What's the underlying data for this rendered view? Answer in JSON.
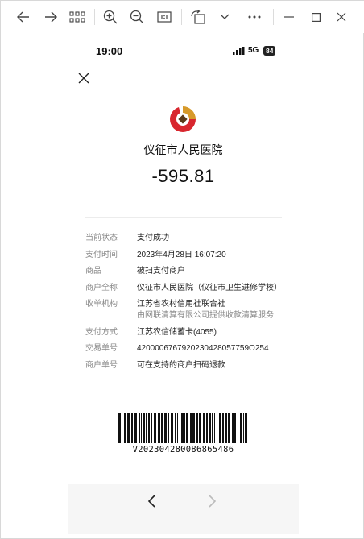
{
  "toolbar": {
    "icons": [
      "back-arrow-icon",
      "forward-arrow-icon",
      "grid-icon",
      "zoom-in-icon",
      "zoom-out-icon",
      "actual-size-icon",
      "rotate-icon",
      "chevron-down-icon",
      "more-icon",
      "minimize-icon",
      "maximize-icon",
      "close-icon"
    ]
  },
  "status_bar": {
    "time": "19:00",
    "network": "5G",
    "battery": "84"
  },
  "receipt": {
    "merchant": "仪征市人民医院",
    "amount": "-595.81",
    "details": [
      {
        "label": "当前状态",
        "value": "支付成功"
      },
      {
        "label": "支付时间",
        "value": "2023年4月28日 16:07:20"
      },
      {
        "label": "商品",
        "value": "被扫支付商户"
      },
      {
        "label": "商户全称",
        "value": "仪征市人民医院（仪征市卫生进修学校）"
      },
      {
        "label": "收单机构",
        "value": "江苏省农村信用社联合社",
        "sub": "由网联清算有限公司提供收款清算服务"
      },
      {
        "label": "支付方式",
        "value": "江苏农信储蓄卡(4055)"
      },
      {
        "label": "交易单号",
        "value": "4200006767920230428057759O254"
      },
      {
        "label": "商户单号",
        "value": "可在支持的商户扫码退款"
      }
    ],
    "barcode_number": "V202304280086865486"
  },
  "colors": {
    "logo_red": "#d8262e",
    "logo_gold": "#d79a2a",
    "navbar_bg": "#f6f6f6"
  }
}
